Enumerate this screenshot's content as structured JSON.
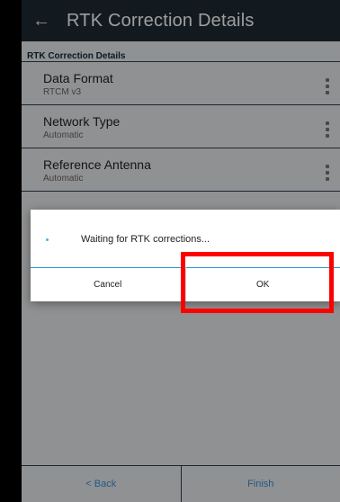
{
  "appbar": {
    "title": "RTK Correction Details"
  },
  "section": {
    "header": "RTK Correction Details"
  },
  "settings": [
    {
      "title": "Data Format",
      "subtitle": "RTCM v3"
    },
    {
      "title": "Network Type",
      "subtitle": "Automatic"
    },
    {
      "title": "Reference Antenna",
      "subtitle": "Automatic"
    }
  ],
  "bottom_bar": {
    "back_label": "< Back",
    "finish_label": "Finish"
  },
  "dialog": {
    "message": "Waiting for RTK corrections...",
    "cancel_label": "Cancel",
    "ok_label": "OK"
  },
  "colors": {
    "appbar": "#1e2a34",
    "accent": "#2f95d0",
    "highlight": "#ff0000"
  },
  "icons": {
    "back": "arrow-left-icon",
    "more": "more-vertical-icon"
  }
}
